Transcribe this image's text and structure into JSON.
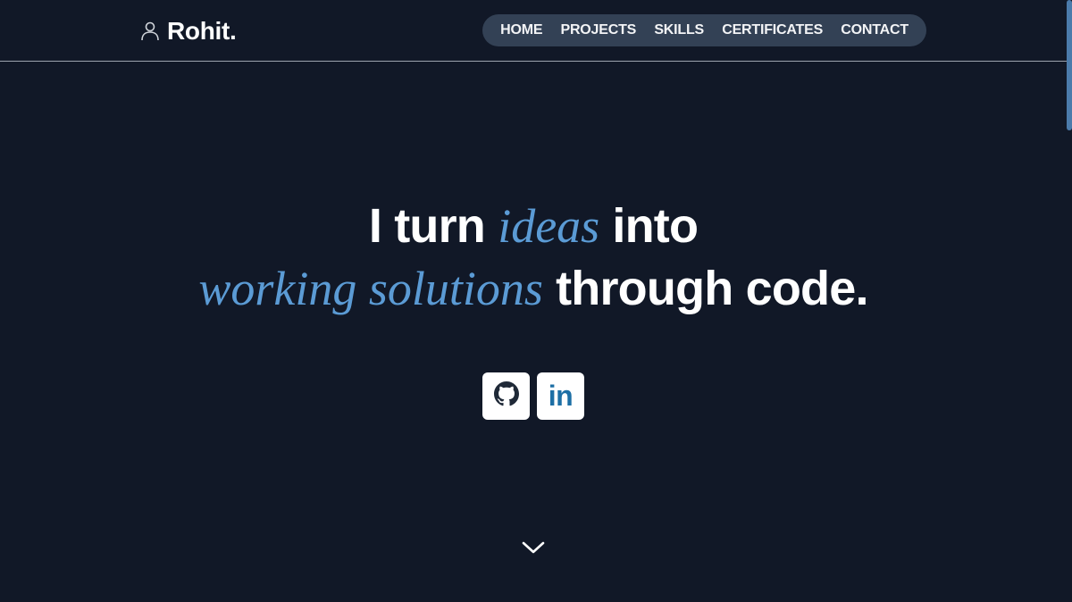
{
  "brand": {
    "name": "Rohit."
  },
  "nav": {
    "items": [
      "HOME",
      "PROJECTS",
      "SKILLS",
      "CERTIFICATES",
      "CONTACT"
    ]
  },
  "hero": {
    "line1": {
      "part1": "I turn ",
      "accent": "ideas",
      "part2": " into"
    },
    "line2": {
      "accent": "working solutions",
      "part2": " through code."
    }
  },
  "socials": {
    "github_icon": "github-icon",
    "linkedin_text": "in"
  },
  "colors": {
    "background": "#111827",
    "nav_bg": "#334155",
    "accent": "#5b9bd5",
    "linkedin_blue": "#1d6fa5"
  }
}
